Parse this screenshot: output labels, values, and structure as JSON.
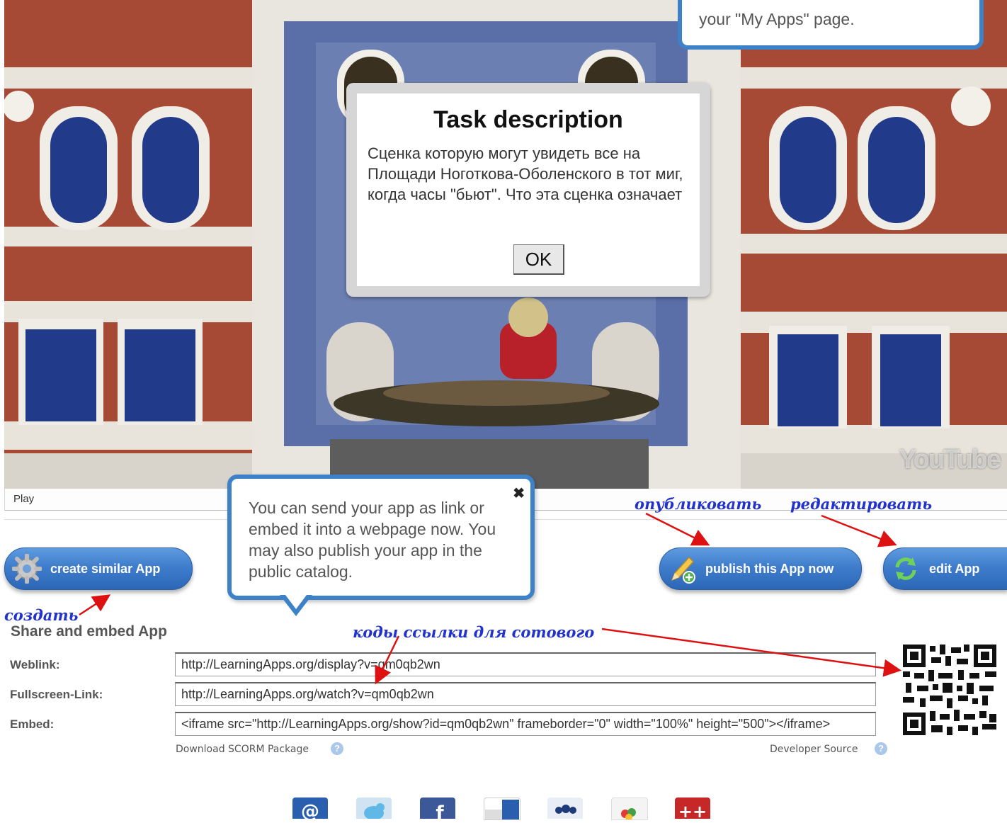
{
  "player": {
    "play_label": "Play",
    "watermark": "YouTube"
  },
  "task_dialog": {
    "title": "Task description",
    "text": "Сценка которую могут увидеть все на Площади Ноготкова-Оболенского в тот миг, когда часы \"бьют\". Что эта сценка означает",
    "ok_label": "OK"
  },
  "tooltip_top": {
    "text": "your \"My Apps\" page."
  },
  "tooltip_mid": {
    "text": "You can send your app as link or embed it into a webpage now. You may also publish your app in the public catalog.",
    "close": "✖"
  },
  "buttons": {
    "create": "create similar App",
    "publish": "publish this App now",
    "edit": "edit App"
  },
  "annotations": {
    "publish": "опубликовать",
    "edit": "редактировать",
    "create": "создать",
    "codes": "коды  ссылки  для  сотового"
  },
  "share": {
    "title": "Share and embed App",
    "weblink_label": "Weblink:",
    "weblink": "http://LearningApps.org/display?v=qm0qb2wn",
    "fullscreen_label": "Fullscreen-Link:",
    "fullscreen": "http://LearningApps.org/watch?v=qm0qb2wn",
    "embed_label": "Embed:",
    "embed": "<iframe src=\"http://LearningApps.org/show?id=qm0qb2wn\" frameborder=\"0\" width=\"100%\" height=\"500\"></iframe>",
    "scorm": "Download SCORM Package",
    "developer": "Developer Source",
    "help": "?"
  },
  "share_icons": [
    "email-icon",
    "twitter-icon",
    "facebook-icon",
    "delicious-icon",
    "myspace-icon",
    "google-icon",
    "hyves-icon"
  ],
  "colors": {
    "accent_blue": "#3d82c8",
    "annotation_blue": "#2233cc",
    "arrow_red": "#dd1111"
  }
}
